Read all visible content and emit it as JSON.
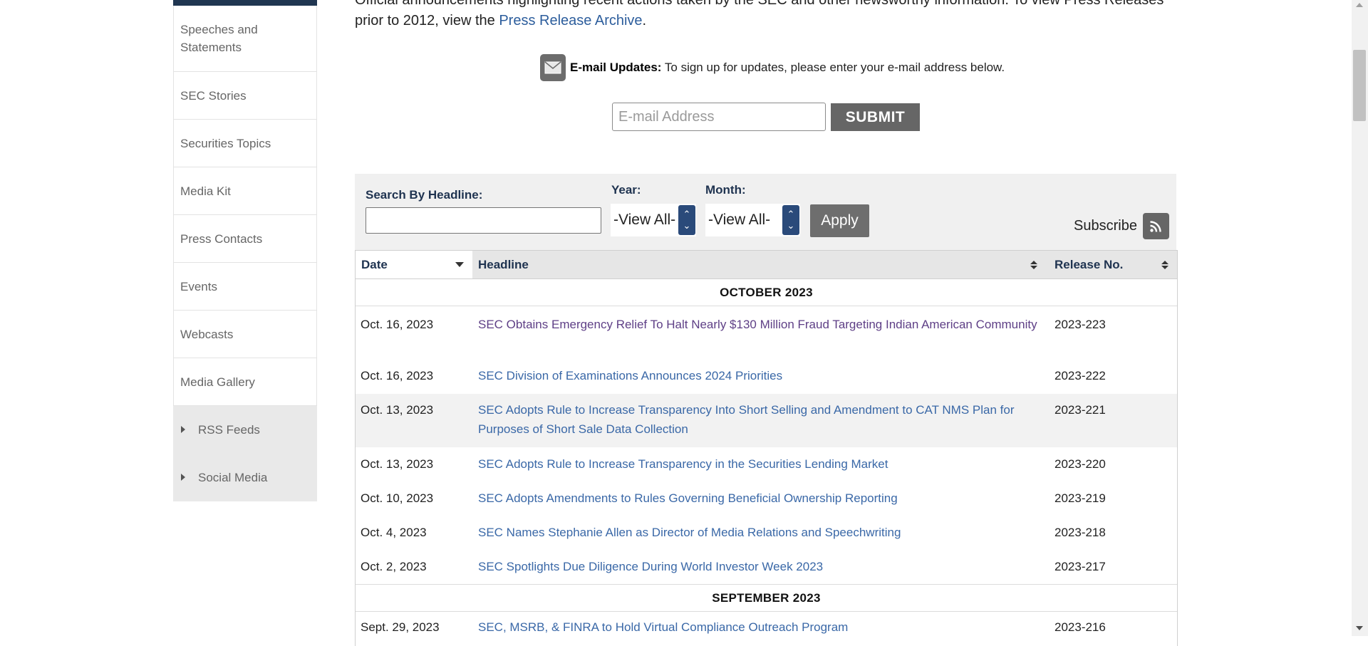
{
  "sidebar": {
    "items": [
      {
        "label": "Speeches and Statements"
      },
      {
        "label": "SEC Stories"
      },
      {
        "label": "Securities Topics"
      },
      {
        "label": "Media Kit"
      },
      {
        "label": "Press Contacts"
      },
      {
        "label": "Events"
      },
      {
        "label": "Webcasts"
      },
      {
        "label": "Media Gallery"
      },
      {
        "label": "RSS Feeds"
      },
      {
        "label": "Social Media"
      }
    ]
  },
  "intro": {
    "line1": "Official announcements highlighting recent actions taken by the SEC and other newsworthy information.  To view Press Releases",
    "line2_prefix": "prior to 2012, view the ",
    "archive_link": "Press Release Archive",
    "line2_suffix": "."
  },
  "email_updates": {
    "label": "E-mail Updates:",
    "text": " To sign up for updates, please enter your e-mail address below.",
    "placeholder": "E-mail Address",
    "submit": "SUBMIT"
  },
  "filters": {
    "search_label": "Search By Headline:",
    "year_label": "Year:",
    "year_value": "-View All-",
    "month_label": "Month:",
    "month_value": "-View All-",
    "apply": "Apply",
    "subscribe": "Subscribe"
  },
  "table": {
    "headers": {
      "date": "Date",
      "headline": "Headline",
      "release": "Release No."
    },
    "months": [
      "OCTOBER 2023",
      "SEPTEMBER 2023"
    ],
    "rows": [
      {
        "date": "Oct. 16, 2023",
        "headline": "SEC Obtains Emergency Relief To Halt Nearly $130 Million Fraud Targeting Indian American Community",
        "release": "2023-223"
      },
      {
        "date": "Oct. 16, 2023",
        "headline": "SEC Division of Examinations Announces 2024 Priorities",
        "release": "2023-222"
      },
      {
        "date": "Oct. 13, 2023",
        "headline": "SEC Adopts Rule to Increase Transparency Into Short Selling and Amendment to CAT NMS Plan for Purposes of Short Sale Data Collection",
        "release": "2023-221"
      },
      {
        "date": "Oct. 13, 2023",
        "headline": "SEC Adopts Rule to Increase Transparency in the Securities Lending Market",
        "release": "2023-220"
      },
      {
        "date": "Oct. 10, 2023",
        "headline": "SEC Adopts Amendments to Rules Governing Beneficial Ownership Reporting",
        "release": "2023-219"
      },
      {
        "date": "Oct. 4, 2023",
        "headline": "SEC Names Stephanie Allen as Director of Media Relations and Speechwriting",
        "release": "2023-218"
      },
      {
        "date": "Oct. 2, 2023",
        "headline": "SEC Spotlights Due Diligence During World Investor Week 2023",
        "release": "2023-217"
      },
      {
        "date": "Sept. 29, 2023",
        "headline": "SEC, MSRB, & FINRA to Hold Virtual Compliance Outreach Program",
        "release": "2023-216"
      }
    ]
  }
}
